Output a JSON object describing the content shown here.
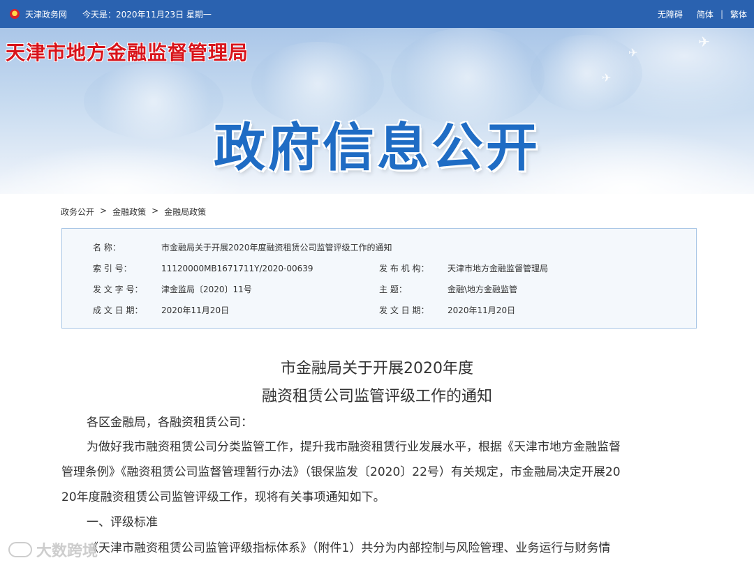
{
  "topbar": {
    "site_name": "天津政务网",
    "date_text": "今天是：2020年11月23日 星期一",
    "accessibility": "无障碍",
    "simplified": "简体",
    "traditional": "繁体",
    "separator": "|"
  },
  "banner": {
    "org_name": "天津市地方金融监督管理局",
    "section_title": "政府信息公开"
  },
  "breadcrumb": {
    "items": [
      "政务公开",
      "金融政策",
      "金融局政策"
    ],
    "separator": ">"
  },
  "info": {
    "name_label": "名 称：",
    "name_value": "市金融局关于开展2020年度融资租赁公司监管评级工作的通知",
    "index_label": "索 引 号：",
    "index_value": "11120000MB1671711Y/2020-00639",
    "issuer_label": "发 布 机 构：",
    "issuer_value": "天津市地方金融监督管理局",
    "docno_label": "发 文 字 号：",
    "docno_value": "津金监局〔2020〕11号",
    "topic_label": "主 题：",
    "topic_value": "金融\\地方金融监管",
    "created_label": "成 文 日 期：",
    "created_value": "2020年11月20日",
    "issued_label": "发 文 日 期：",
    "issued_value": "2020年11月20日"
  },
  "article": {
    "title_line1": "市金融局关于开展2020年度",
    "title_line2": "融资租赁公司监管评级工作的通知",
    "salutation": "各区金融局，各融资租赁公司：",
    "p1_line1": "为做好我市融资租赁公司分类监管工作，提升我市融资租赁行业发展水平，根据《天津市地方金融监督",
    "p1_line2": "管理条例》《融资租赁公司监督管理暂行办法》（银保监发〔2020〕22号）有关规定，市金融局决定开展20",
    "p1_line3": "20年度融资租赁公司监管评级工作，现将有关事项通知如下。",
    "heading1": "一、评级标准",
    "p2_line1": "《天津市融资租赁公司监管评级指标体系》（附件1）共分为内部控制与风险管理、业务运行与财务情"
  },
  "watermark": "大数跨境"
}
